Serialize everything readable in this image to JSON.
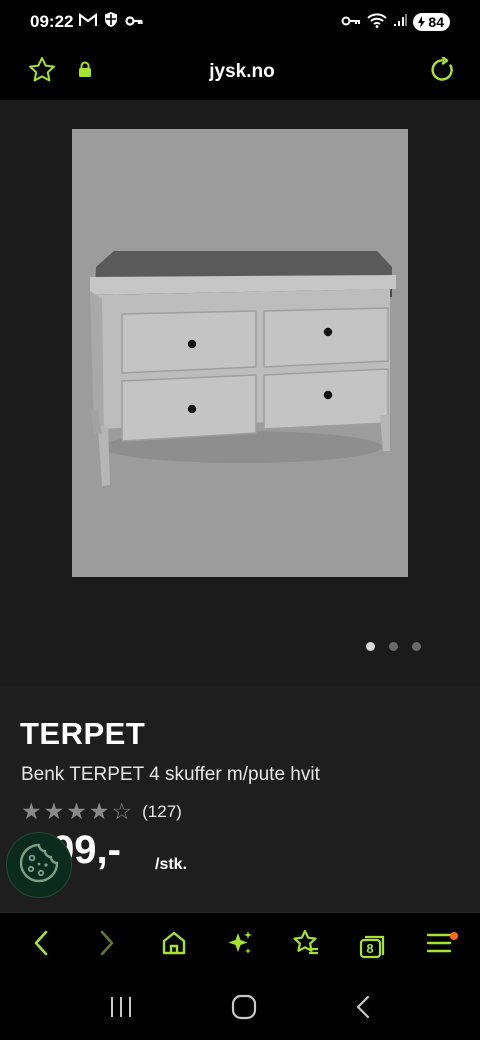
{
  "status_bar": {
    "time": "09:22",
    "battery": "84",
    "icons": [
      "gmail-icon",
      "shield-icon",
      "key-icon",
      "vpn-key-icon",
      "wifi-icon",
      "signal-icon",
      "battery-icon"
    ]
  },
  "browser": {
    "url": "jysk.no",
    "icons": [
      "favorite-star-icon",
      "lock-icon",
      "reload-icon"
    ]
  },
  "gallery": {
    "image_alt": "Benk TERPET 4 skuffer m/pute hvit",
    "dots_total": 3,
    "active_index": 0
  },
  "product": {
    "brand": "TERPET",
    "title": "Benk TERPET 4 skuffer m/pute hvit",
    "rating_stars": 4,
    "rating_max": 5,
    "review_count": "(127)",
    "price": "999,-",
    "price_visible": "99,-",
    "unit": "/stk."
  },
  "cookie_button": {
    "icon": "cookie-icon"
  },
  "bottom_nav": {
    "items": [
      {
        "name": "back-icon"
      },
      {
        "name": "forward-icon"
      },
      {
        "name": "home-icon"
      },
      {
        "name": "sparkle-icon"
      },
      {
        "name": "bookmark-star-icon"
      },
      {
        "name": "tabs-icon",
        "count": "8"
      },
      {
        "name": "menu-icon"
      }
    ],
    "accent": "#a6e22e"
  },
  "system_nav": [
    "recents-icon",
    "home-circle-icon",
    "system-back-icon"
  ]
}
